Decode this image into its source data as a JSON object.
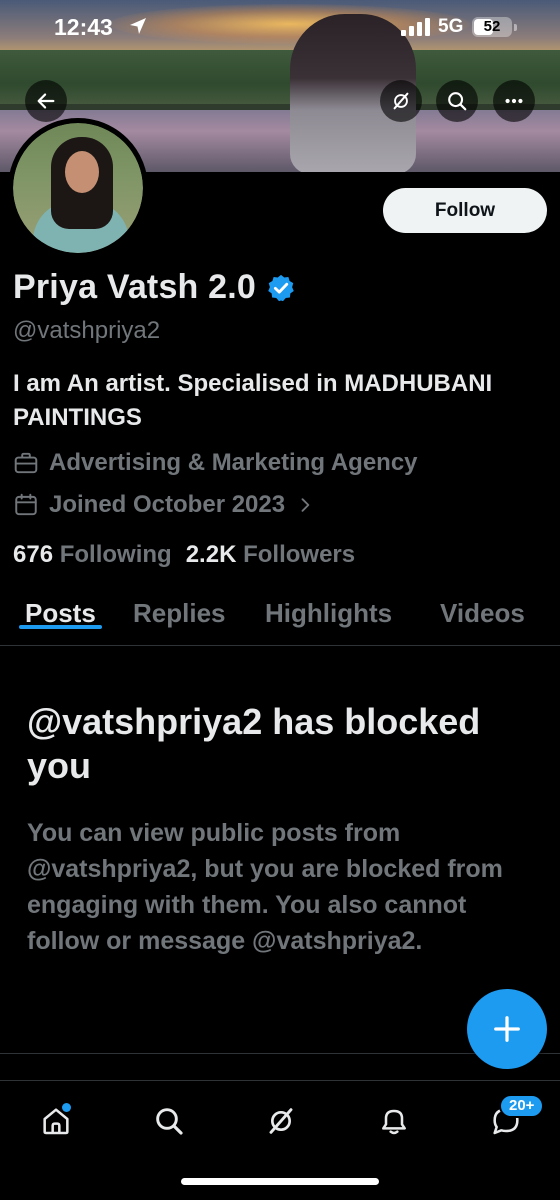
{
  "status_bar": {
    "time": "12:43",
    "network": "5G",
    "battery_level": "52",
    "battery_fraction": 0.52
  },
  "banner": {
    "back_icon": "arrow-left-icon",
    "actions": [
      "grok-icon",
      "search-icon",
      "more-icon"
    ]
  },
  "profile": {
    "display_name": "Priya Vatsh 2.0",
    "verified": true,
    "handle": "@vatshpriya2",
    "bio": "I am An artist. Specialised in MADHUBANI PAINTINGS",
    "category": "Advertising & Marketing Agency",
    "joined": "Joined October 2023",
    "following_count": "676",
    "following_label": "Following",
    "followers_count": "2.2K",
    "followers_label": "Followers",
    "follow_button": "Follow"
  },
  "tabs": [
    {
      "label": "Posts",
      "active": true
    },
    {
      "label": "Replies",
      "active": false
    },
    {
      "label": "Highlights",
      "active": false
    },
    {
      "label": "Videos",
      "active": false
    }
  ],
  "blocked": {
    "title": "@vatshpriya2 has blocked you",
    "description": "You can view public posts from @vatshpriya2, but you are blocked from engaging with them. You also cannot follow or message @vatshpriya2."
  },
  "bottom_nav": {
    "items": [
      "home-icon",
      "search-icon",
      "grok-icon",
      "notifications-icon",
      "messages-icon"
    ],
    "messages_badge": "20+"
  },
  "colors": {
    "accent": "#1d9bf0",
    "text_primary": "#e7e9ea",
    "text_secondary": "#71767b",
    "background": "#000000"
  }
}
